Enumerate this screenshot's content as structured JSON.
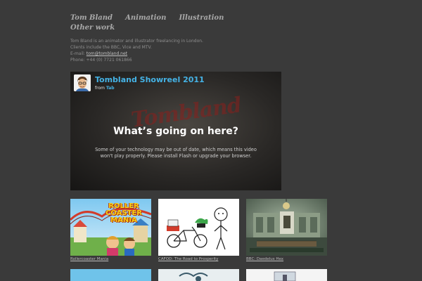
{
  "nav": {
    "items": [
      "Tom Bland",
      "Animation",
      "Illustration",
      "Other work"
    ]
  },
  "bio": {
    "line1": "Tom Bland is an animator and illustrator freelancing in London.",
    "line2": "Clients include the BBC, Vice and MTV.",
    "email_label": "E-mail:",
    "email": "tom@tombland.net",
    "phone": "Phone: +44 (0) 7721 061866"
  },
  "video": {
    "title": "Tombland Showreel 2011",
    "from_label": "from",
    "from_user": "Tab",
    "watermark": "Tombland",
    "heading": "What’s going on here?",
    "message": "Some of your technology may be out of date, which means this video won't play properly. Please install Flash or upgrade your browser."
  },
  "thumbnails": [
    {
      "caption": "Rollercoaster Mania",
      "art_text": "ROLLER COASTER MANIA"
    },
    {
      "caption": "CAFOD: The Road to Prosperity"
    },
    {
      "caption": "BBC: Daedelus Hex"
    }
  ],
  "colors": {
    "background": "#3a3a3a",
    "link_blue": "#45b3e6",
    "nav_text": "#a9a9a9"
  }
}
